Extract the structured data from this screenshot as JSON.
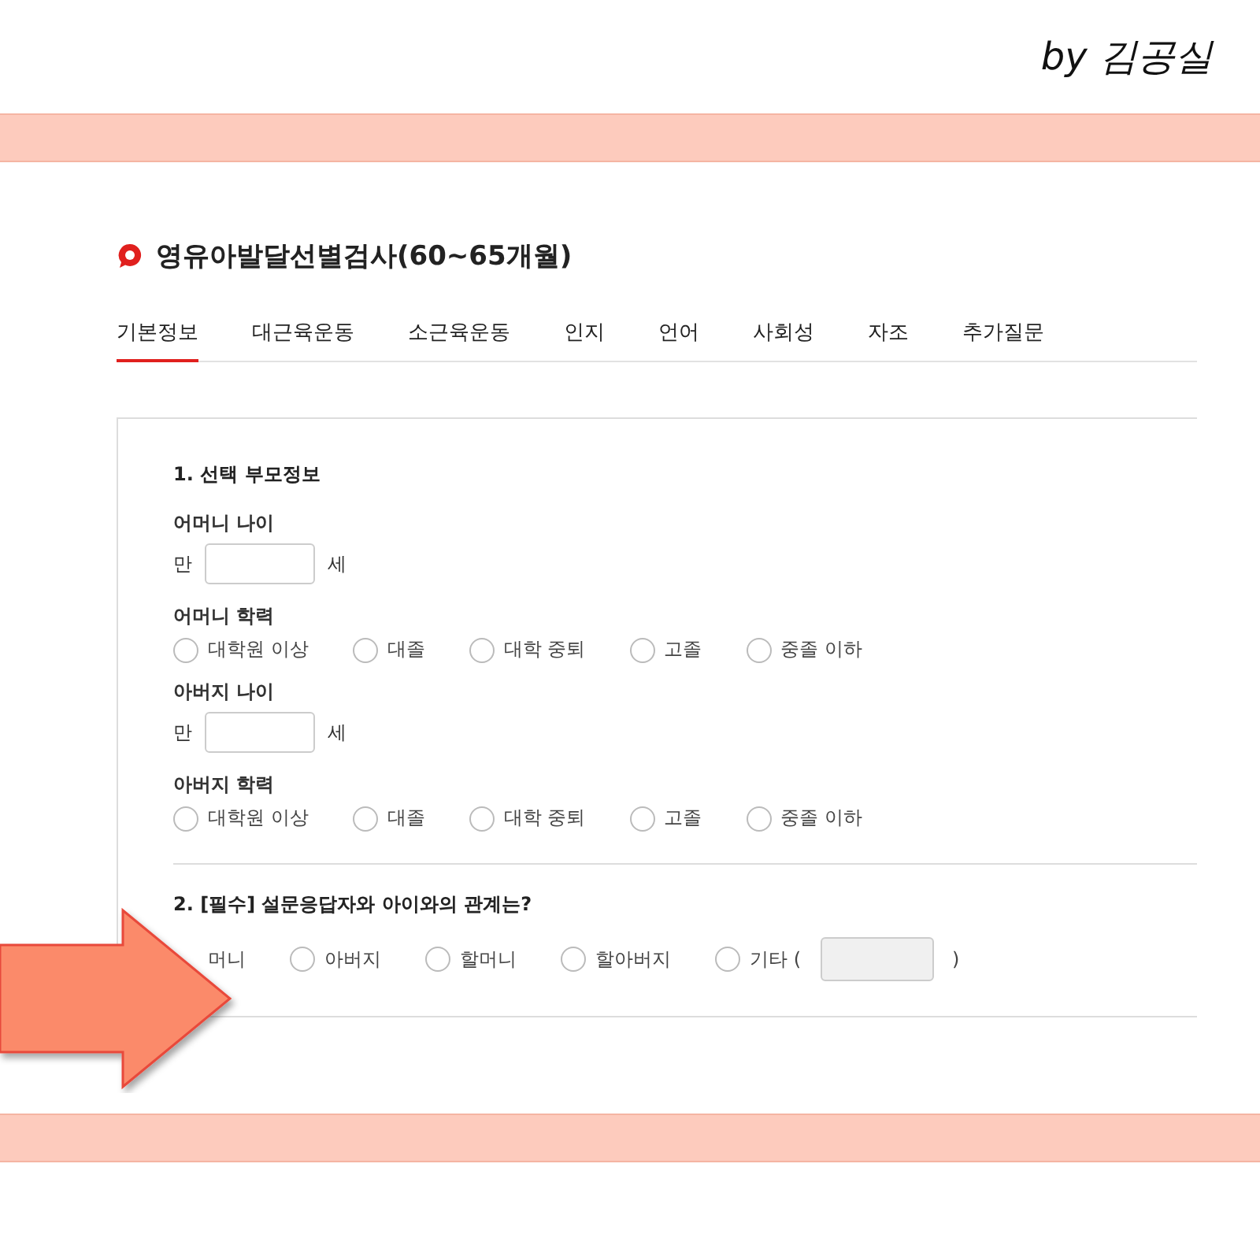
{
  "signature": "by 김공실",
  "title": "영유아발달선별검사(60~65개월)",
  "tabs": [
    {
      "label": "기본정보",
      "selected": true
    },
    {
      "label": "대근육운동",
      "selected": false
    },
    {
      "label": "소근육운동",
      "selected": false
    },
    {
      "label": "인지",
      "selected": false
    },
    {
      "label": "언어",
      "selected": false
    },
    {
      "label": "사회성",
      "selected": false
    },
    {
      "label": "자조",
      "selected": false
    },
    {
      "label": "추가질문",
      "selected": false
    }
  ],
  "sections": [
    {
      "heading": "1. 선택 부모정보",
      "fields": [
        {
          "kind": "age",
          "label": "어머니 나이",
          "prefix": "만",
          "suffix": "세"
        },
        {
          "kind": "choice",
          "label": "어머니 학력",
          "options": [
            {
              "label": "대학원 이상",
              "selected": false
            },
            {
              "label": "대졸",
              "selected": false
            },
            {
              "label": "대학 중퇴",
              "selected": false
            },
            {
              "label": "고졸",
              "selected": false
            },
            {
              "label": "중졸 이하",
              "selected": false
            }
          ]
        },
        {
          "kind": "age",
          "label": "아버지 나이",
          "prefix": "만",
          "suffix": "세"
        },
        {
          "kind": "choice",
          "label": "아버지 학력",
          "options": [
            {
              "label": "대학원 이상",
              "selected": false
            },
            {
              "label": "대졸",
              "selected": false
            },
            {
              "label": "대학 중퇴",
              "selected": false
            },
            {
              "label": "고졸",
              "selected": false
            },
            {
              "label": "중졸 이하",
              "selected": false
            }
          ]
        }
      ]
    },
    {
      "heading": "2. [필수] 설문응답자와 아이와의 관계는?",
      "fields": [
        {
          "kind": "choice",
          "options": [
            {
              "label": "머니"
            },
            {
              "label": "아버지",
              "selected": false
            },
            {
              "label": "할머니",
              "selected": false
            },
            {
              "label": "할아버지",
              "selected": false
            },
            {
              "label": "기타 (",
              "selected": false,
              "other_close": ")"
            }
          ]
        }
      ]
    }
  ]
}
